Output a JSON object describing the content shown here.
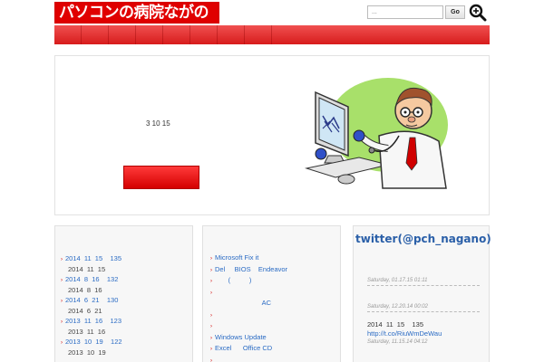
{
  "header": {
    "logo_text": "パソコンの病院ながの",
    "search": {
      "placeholder": "...",
      "button_label": "Go"
    },
    "nav_item_count": 8,
    "icons": {
      "search": "magnifier-plus-icon"
    }
  },
  "colors": {
    "brand_red": "#e00000",
    "link_blue": "#2a6bc4",
    "twitter_blue": "#2a5fa8"
  },
  "main": {
    "date_text": "3   10  15",
    "illustration": "doctor-with-computer-illustration"
  },
  "archive": {
    "items": [
      {
        "link": "2014  11  15    135",
        "sub": "2014  11  15"
      },
      {
        "link": "2014  8  16    132",
        "sub": "2014  8  16"
      },
      {
        "link": "2014  6  21    130",
        "sub": "2014  6  21"
      },
      {
        "link": "2013  11  16    123",
        "sub": "2013  11  16"
      },
      {
        "link": "2013  10  19    122",
        "sub": "2013  10  19"
      }
    ]
  },
  "links": {
    "items": [
      "Microsoft Fix it",
      "Del     BIOS    Endeavor",
      "       (          )",
      "",
      "                         AC",
      "",
      "",
      "Windows Update",
      "Excel      Office CD",
      ""
    ]
  },
  "twitter": {
    "title": "twitter(@pch_nagano)",
    "tweets": [
      {
        "text": "",
        "link": "",
        "time": "Saturday, 01.17.15 01:11"
      },
      {
        "text": "",
        "link": "",
        "time": "Saturday, 12.20.14 00:02"
      },
      {
        "text": "2014  11  15    135",
        "link": "http://t.co/RiuWmDeWau",
        "time": "Saturday, 11.15.14 04:12"
      }
    ]
  }
}
